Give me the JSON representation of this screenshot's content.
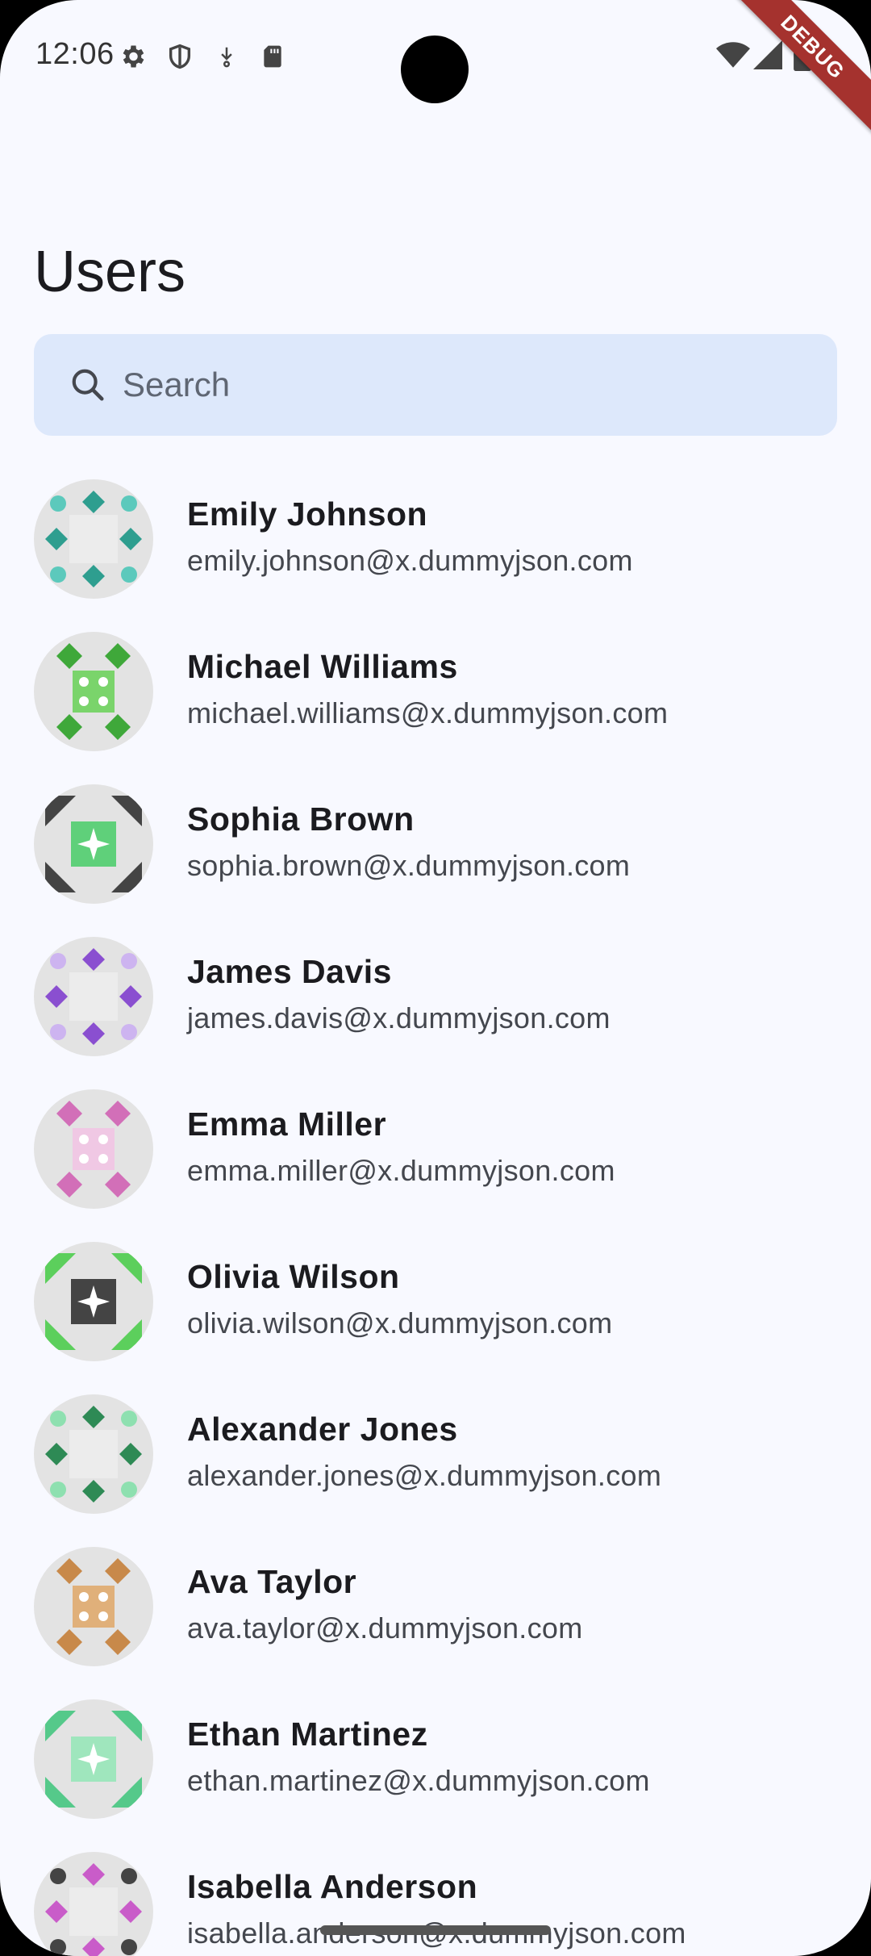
{
  "status_bar": {
    "time": "12:06",
    "left_icons": [
      "settings-icon",
      "shield-icon",
      "download-icon",
      "sd-card-icon"
    ],
    "right_icons": [
      "wifi-icon",
      "signal-icon",
      "battery-icon"
    ],
    "debug_banner": "DEBUG"
  },
  "header": {
    "title": "Users"
  },
  "search": {
    "placeholder": "Search",
    "value": ""
  },
  "users": [
    {
      "name": "Emily Johnson",
      "email": "emily.johnson@x.dummyjson.com",
      "color": "#2e9e8f",
      "accent": "#5cc9bc"
    },
    {
      "name": "Michael Williams",
      "email": "michael.williams@x.dummyjson.com",
      "color": "#3fa83a",
      "accent": "#7ad46b"
    },
    {
      "name": "Sophia Brown",
      "email": "sophia.brown@x.dummyjson.com",
      "color": "#444444",
      "accent": "#5fd07a"
    },
    {
      "name": "James Davis",
      "email": "james.davis@x.dummyjson.com",
      "color": "#8a4fd0",
      "accent": "#cdb4f0"
    },
    {
      "name": "Emma Miller",
      "email": "emma.miller@x.dummyjson.com",
      "color": "#d26fb8",
      "accent": "#f0c8e4"
    },
    {
      "name": "Olivia Wilson",
      "email": "olivia.wilson@x.dummyjson.com",
      "color": "#5ccf5c",
      "accent": "#444444"
    },
    {
      "name": "Alexander Jones",
      "email": "alexander.jones@x.dummyjson.com",
      "color": "#2e8a55",
      "accent": "#8ee0b0"
    },
    {
      "name": "Ava Taylor",
      "email": "ava.taylor@x.dummyjson.com",
      "color": "#c8894a",
      "accent": "#e0b07a"
    },
    {
      "name": "Ethan Martinez",
      "email": "ethan.martinez@x.dummyjson.com",
      "color": "#55c98a",
      "accent": "#9fe6bd"
    },
    {
      "name": "Isabella Anderson",
      "email": "isabella.anderson@x.dummyjson.com",
      "color": "#c95cc9",
      "accent": "#444444"
    }
  ]
}
